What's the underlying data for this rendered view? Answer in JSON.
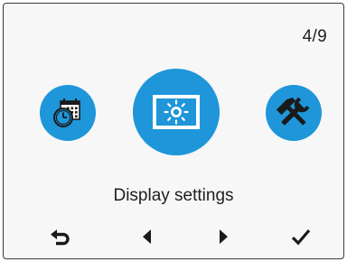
{
  "page_indicator": "4/9",
  "menu": {
    "selected_label": "Display settings",
    "items": [
      {
        "icon": "clock-calendar-icon",
        "position": "left"
      },
      {
        "icon": "display-brightness-icon",
        "position": "center",
        "selected": true
      },
      {
        "icon": "tools-icon",
        "position": "right"
      }
    ]
  },
  "navigation": {
    "buttons": [
      {
        "icon": "back-arrow-icon"
      },
      {
        "icon": "previous-triangle-icon"
      },
      {
        "icon": "next-triangle-icon"
      },
      {
        "icon": "checkmark-icon"
      }
    ]
  },
  "colors": {
    "accent": "#1e96d9",
    "icon_dark": "#1a1a1a",
    "background": "#f7f7f7"
  }
}
